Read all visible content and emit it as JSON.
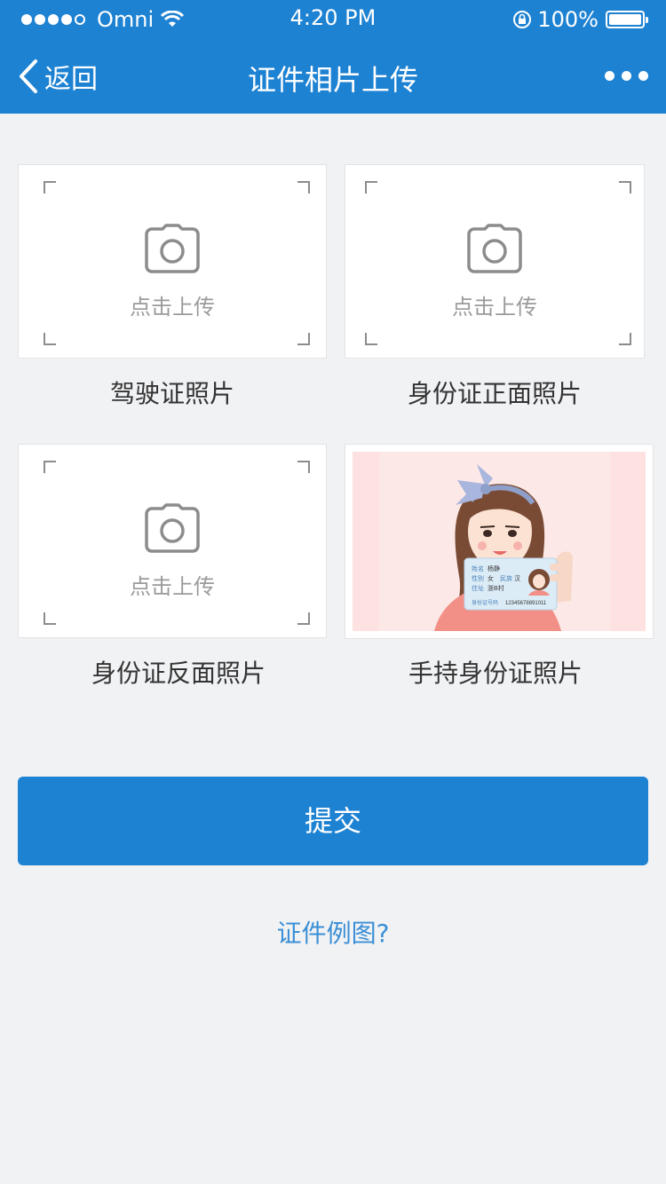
{
  "status_bar": {
    "carrier": "Omni",
    "time": "4:20 PM",
    "battery": "100%"
  },
  "nav": {
    "back_label": "返回",
    "title": "证件相片上传"
  },
  "upload_cards": [
    {
      "label": "驾驶证照片",
      "placeholder": "点击上传"
    },
    {
      "label": "身份证正面照片",
      "placeholder": "点击上传"
    },
    {
      "label": "身份证反面照片",
      "placeholder": "点击上传"
    },
    {
      "label": "手持身份证照片"
    }
  ],
  "id_card_sample": {
    "name_label": "姓名",
    "name_value": "杨静",
    "gender_label": "性别",
    "gender_value": "女",
    "ethnicity_label": "民族",
    "ethnicity_value": "汉",
    "address_label": "住址",
    "address_value": "浙B村",
    "id_label": "身份证号码",
    "id_value": "12345678891011"
  },
  "submit_label": "提交",
  "example_link": "证件例图?",
  "colors": {
    "primary": "#1e82d2",
    "background": "#f1f2f4",
    "link": "#3b8fd6"
  }
}
